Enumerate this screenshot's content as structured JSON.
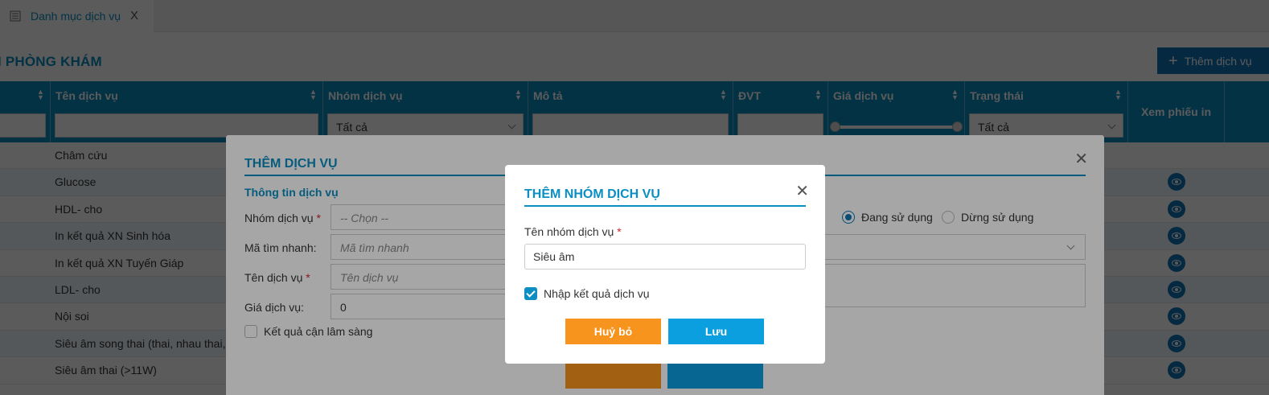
{
  "tab": {
    "label": "Danh mục dịch vụ",
    "close": "X"
  },
  "page": {
    "title": "I PHÒNG KHÁM",
    "add_button": "Thêm dịch vụ"
  },
  "grid": {
    "columns": [
      "Tên dịch vụ",
      "Nhóm dịch vụ",
      "Mô tả",
      "ĐVT",
      "Giá dịch vụ",
      "Trạng thái",
      "Xem phiếu in"
    ],
    "filters": {
      "group": "Tất cả",
      "status": "Tất cả"
    },
    "rows": [
      "Châm cứu",
      "Glucose",
      "HDL- cho",
      "In kết quả XN Sinh hóa",
      "In kết quả XN Tuyến Giáp",
      "LDL- cho",
      "Nội soi",
      "Siêu âm song thai (thai, nhau thai, n",
      "Siêu âm thai (>11W)"
    ]
  },
  "add_service_modal": {
    "title": "THÊM DỊCH VỤ",
    "section": "Thông tin dịch vụ",
    "group_label": "Nhóm dịch vụ",
    "group_placeholder": "-- Chọn --",
    "code_label": "Mã tìm nhanh",
    "code_placeholder": "Mã tìm nhanh",
    "name_label": "Tên dịch vụ",
    "name_placeholder": "Tên dịch vụ",
    "price_label": "Giá dịch vụ",
    "price_value": "0",
    "clinical_label": "Kết quả cận lâm sàng",
    "status_active": "Đang sử dụng",
    "status_inactive": "Dừng sử dụng"
  },
  "add_group_modal": {
    "title": "THÊM NHÓM DỊCH VỤ",
    "name_label": "Tên nhóm dịch vụ",
    "name_value": "Siêu âm",
    "result_checkbox_label": "Nhập kết quả dịch vụ",
    "result_checkbox_checked": true,
    "cancel": "Huỷ bỏ",
    "save": "Lưu"
  },
  "colors": {
    "primary": "#0b8ec2",
    "cancel": "#f7941d",
    "save": "#0b9fe0",
    "required": "#d9232d"
  }
}
